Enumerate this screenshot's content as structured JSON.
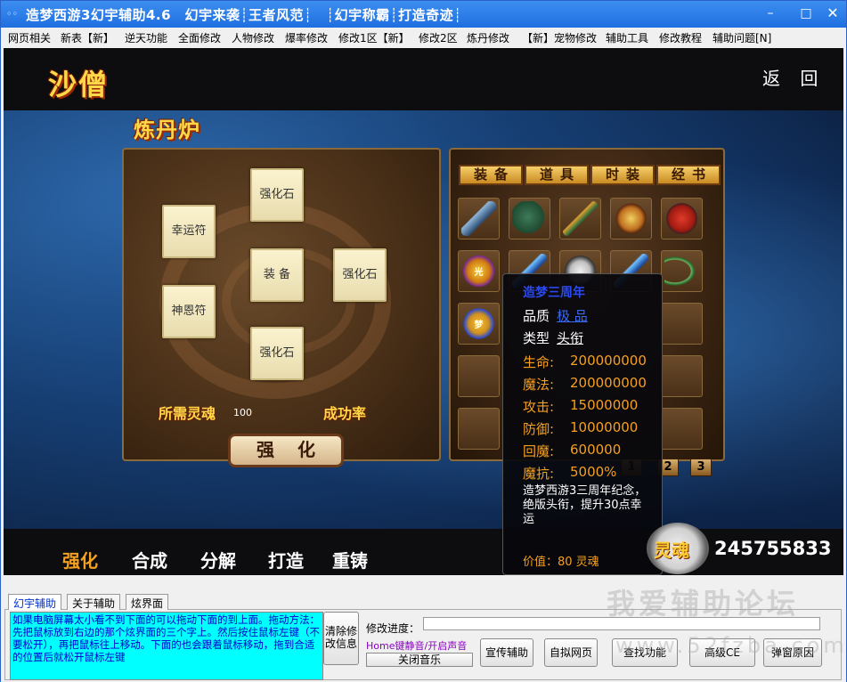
{
  "window": {
    "title": "造梦西游3幻宇辅助4.6　幻宇来袭┊王者风范┊　┊幻宇称霸┊打造奇迹┊",
    "minimize": "–",
    "maximize": "□",
    "close": "✕"
  },
  "menu": [
    "网页相关",
    "新表【新】",
    "逆天功能",
    "全面修改",
    "人物修改",
    "爆率修改",
    "修改1区【新】",
    "修改2区",
    "炼丹修改",
    "【新】宠物修改",
    "辅助工具",
    "修改教程",
    "辅助问题[N]"
  ],
  "game": {
    "character_name": "沙僧",
    "back_label": "返 回",
    "furnace_title": "炼丹炉",
    "slots": {
      "lucky": "幸运符",
      "strengthen_stone_top": "强化石",
      "equipment": "装 备",
      "strengthen_stone_right": "强化石",
      "grace": "神恩符",
      "strengthen_stone_bottom": "强化石"
    },
    "required_soul_label": "所需灵魂",
    "required_soul_value": "100",
    "success_rate_label": "成功率",
    "strengthen_button": "强化",
    "inventory_tabs": [
      "装备",
      "道具",
      "时装",
      "经书"
    ],
    "inventory_items": [
      {
        "icon": "sword-icon"
      },
      {
        "icon": "fan-icon"
      },
      {
        "icon": "spear-icon"
      },
      {
        "icon": "flower-icon"
      },
      {
        "icon": "mask-icon"
      },
      {
        "icon": "light-badge-icon",
        "text": "光"
      },
      {
        "icon": "blade-icon"
      },
      {
        "icon": "skull-icon"
      },
      {
        "icon": "blade-icon"
      },
      {
        "icon": "bow-icon"
      },
      {
        "icon": "dream-badge-icon",
        "text": "梦"
      }
    ],
    "pages": [
      "1",
      "2",
      "3"
    ],
    "bottom_tabs": [
      "强化",
      "合成",
      "分解",
      "打造",
      "重铸"
    ],
    "soul_icon_label": "灵魂",
    "soul_total": "245755833",
    "tooltip": {
      "name": "造梦三周年",
      "quality_label": "品质",
      "quality_value": "极 品",
      "type_label": "类型",
      "type_value": "头衔",
      "stats": [
        {
          "label": "生命:",
          "value": "200000000"
        },
        {
          "label": "魔法:",
          "value": "200000000"
        },
        {
          "label": "攻击:",
          "value": "15000000"
        },
        {
          "label": "防御:",
          "value": "10000000"
        },
        {
          "label": "回魔:",
          "value": "600000"
        },
        {
          "label": "魔抗:",
          "value": "5000%"
        }
      ],
      "description": "造梦西游3三周年纪念，绝版头衔，提升30点幸运",
      "price": "价值：80 灵魂"
    }
  },
  "lower": {
    "tabs": [
      "幻宇辅助",
      "关于辅助",
      "炫界面"
    ],
    "help_text": "如果电脑屏幕太小看不到下面的可以拖动下面的到上面。拖动方法：先把鼠标放到右边的那个炫界面的三个字上。然后按住鼠标左键（不要松开），再把鼠标往上移动。下面的也会跟着鼠标移动，拖到合适的位置后就松开鼠标左键",
    "clear_button": "清除修改信息",
    "progress_label": "修改进度：",
    "progress": 0,
    "music_hint": "Home键静音/开启声音",
    "close_music": "关闭音乐",
    "buttons": [
      "宣传辅助",
      "自拟网页",
      "查找功能",
      "高级CE",
      "弹窗原因"
    ]
  },
  "watermark": {
    "line1": "我爱辅助论坛",
    "line2": "www.52fzba.com"
  }
}
